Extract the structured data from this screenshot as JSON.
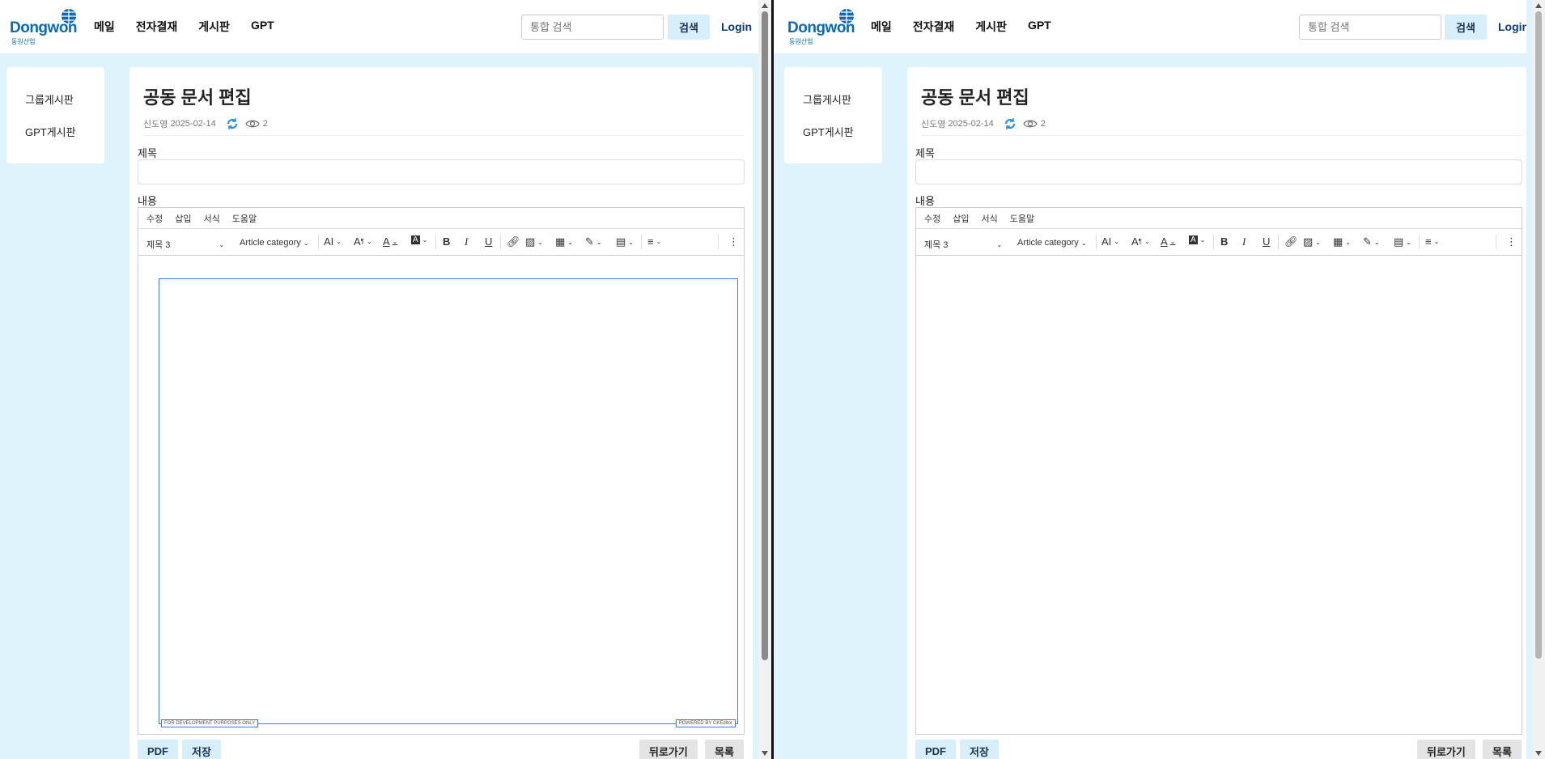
{
  "nav": {
    "logo_text": "Dongwon",
    "logo_sub": "동원산업",
    "menu": [
      "메일",
      "전자결재",
      "게시판",
      "GPT"
    ],
    "search_placeholder": "통합 검색",
    "search_button": "검색",
    "login": "Login"
  },
  "sidebar": {
    "items": [
      "그룹게시판",
      "GPT게시판"
    ]
  },
  "doc": {
    "title": "공동 문서 편집",
    "author": "신도영",
    "date": "2025-02-14",
    "views": "2",
    "subject_label": "제목",
    "content_label": "내용"
  },
  "editor": {
    "menubar": [
      "수정",
      "삽입",
      "서식",
      "도움말"
    ],
    "heading_select": "제목 3",
    "category_select": "Article category",
    "dev_badge": "FOR DEVELOPMENT PURPOSES ONLY",
    "powered_badge": "POWERED BY CKEditor"
  },
  "buttons": {
    "pdf": "PDF",
    "save": "저장",
    "back": "뒤로가기",
    "list": "목록"
  },
  "colors": {
    "accent": "#d6effb",
    "background": "#dff3fc",
    "brand": "#0a6ab3"
  }
}
